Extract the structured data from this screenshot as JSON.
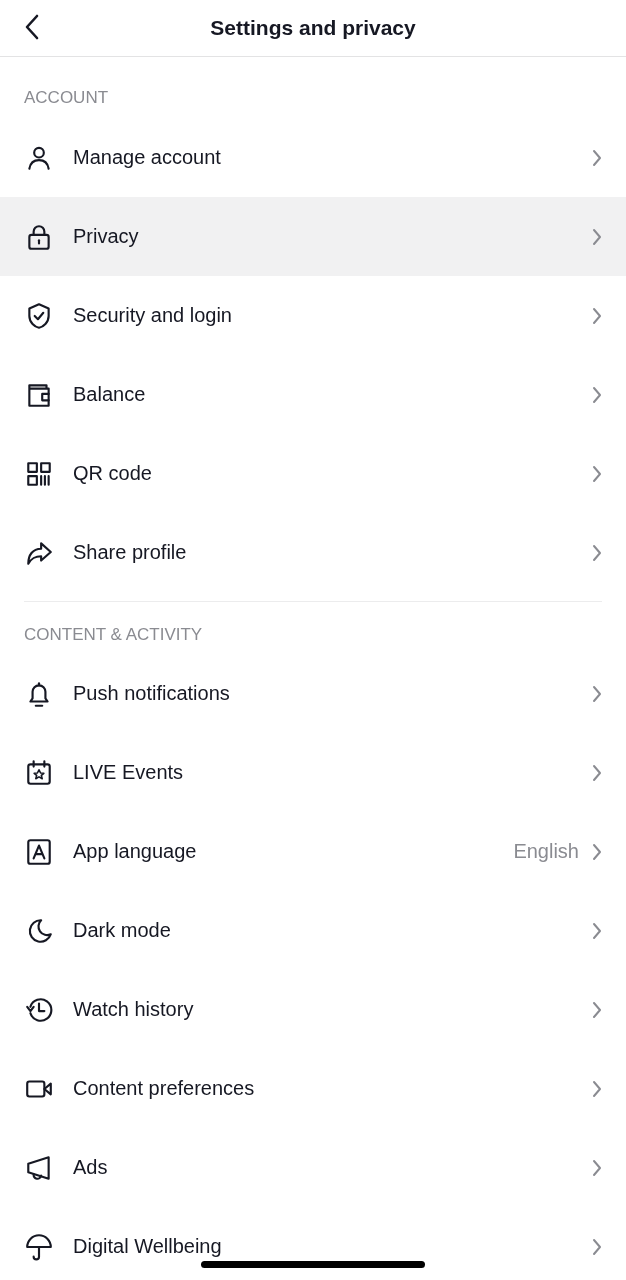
{
  "header": {
    "title": "Settings and privacy"
  },
  "sections": [
    {
      "title": "ACCOUNT",
      "items": [
        {
          "label": "Manage account",
          "selected": false
        },
        {
          "label": "Privacy",
          "selected": true
        },
        {
          "label": "Security and login",
          "selected": false
        },
        {
          "label": "Balance",
          "selected": false
        },
        {
          "label": "QR code",
          "selected": false
        },
        {
          "label": "Share profile",
          "selected": false
        }
      ]
    },
    {
      "title": "CONTENT & ACTIVITY",
      "items": [
        {
          "label": "Push notifications",
          "selected": false
        },
        {
          "label": "LIVE Events",
          "selected": false
        },
        {
          "label": "App language",
          "value": "English",
          "selected": false
        },
        {
          "label": "Dark mode",
          "selected": false
        },
        {
          "label": "Watch history",
          "selected": false
        },
        {
          "label": "Content preferences",
          "selected": false
        },
        {
          "label": "Ads",
          "selected": false
        },
        {
          "label": "Digital Wellbeing",
          "selected": false
        }
      ]
    }
  ]
}
